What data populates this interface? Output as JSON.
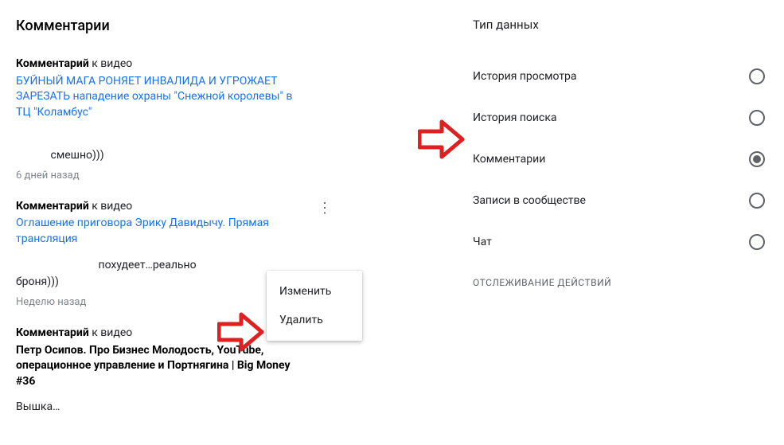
{
  "left": {
    "title": "Комментарии",
    "comment_prefix": "Комментарий",
    "to_video": " к видео",
    "items": [
      {
        "video_title": "БУЙНЫЙ МАГА РОНЯЕТ ИНВАЛИДА И УГРОЖАЕТ ЗАРЕЗАТЬ нападение охраны \"Снежной королевы\" в ТЦ \"Коламбус\"",
        "is_link": true,
        "body_suffix": "смешно)))",
        "timestamp": "6 дней назад",
        "kebab": false
      },
      {
        "video_title": "Оглашение приговора Эрику Давидычу. Прямая трансляция",
        "is_link": true,
        "body_prefix": "",
        "body_mid": "похудеет…реально",
        "body_suffix": "броня)))",
        "timestamp": "Неделю назад",
        "kebab": true
      },
      {
        "video_title": "Петр Осипов. Про Бизнес Молодость, YouTube, операционное управление и Портнягина | Big Money #36",
        "is_link": false,
        "body_suffix": "Вышка…",
        "timestamp": "",
        "kebab": false
      }
    ],
    "menu": {
      "edit": "Изменить",
      "delete": "Удалить"
    }
  },
  "right": {
    "title": "Тип данных",
    "options": [
      {
        "label": "История просмотра",
        "selected": false
      },
      {
        "label": "История поиска",
        "selected": false
      },
      {
        "label": "Комментарии",
        "selected": true
      },
      {
        "label": "Записи в сообществе",
        "selected": false
      },
      {
        "label": "Чат",
        "selected": false
      }
    ],
    "tracking_header": "ОТСЛЕЖИВАНИЕ ДЕЙСТВИЙ"
  }
}
